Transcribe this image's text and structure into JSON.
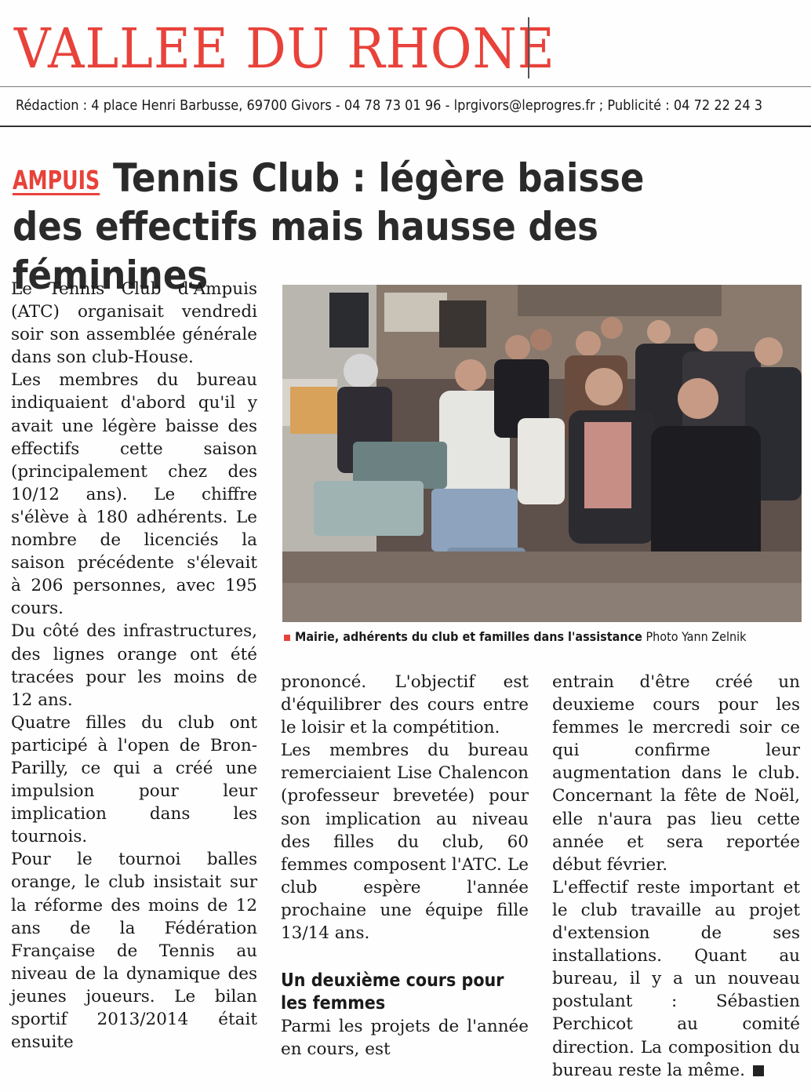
{
  "masthead": {
    "section": "VALLEE DU RHONE",
    "contact": "Rédaction : 4 place Henri Barbusse, 69700 Givors - 04 78 73 01 96 - lprgivors@leprogres.fr ; Publicité : 04 72 22 24 3"
  },
  "article": {
    "kicker": "AMPUIS",
    "headline_1": "Tennis Club : légère baisse",
    "headline_2": "des effectifs mais hausse des féminines",
    "col1": [
      "Le Tennis Club d'Ampuis (ATC) organisait vendredi soir son assemblée générale dans son club-House.",
      "Les membres du bureau indiquaient d'abord qu'il y avait une légère baisse des effectifs cette saison (principalement chez des 10/12 ans). Le chiffre s'élève à 180 adhérents. Le nombre de licenciés la saison précédente s'élevait à 206 personnes, avec 195 cours.",
      "Du côté des infrastructures, des lignes orange ont été tracées pour les moins de 12 ans.",
      "Quatre filles du club ont participé à l'open de Bron-Parilly, ce qui a créé une impulsion pour leur implication dans les tournois.",
      "Pour le tournoi balles orange, le club insistait sur la réforme des moins de 12 ans de la Fédération Française de Tennis au niveau de la dynamique des jeunes joueurs. Le bilan sportif 2013/2014 était ensuite"
    ],
    "col2": [
      "prononcé. L'objectif est d'équilibrer des cours entre le loisir et la compétition.",
      "Les membres du bureau remerciaient Lise Chalencon (professeur brevetée) pour son implication au niveau des filles du club, 60 femmes composent l'ATC. Le club espère l'année prochaine une équipe fille 13/14 ans."
    ],
    "subhead": "Un deuxième cours pour les femmes",
    "col2_after": "Parmi les projets de l'année en cours, est",
    "col3": [
      "entrain d'être créé un deuxieme cours pour les femmes le mercredi soir ce qui confirme leur augmentation dans le club. Concernant la fête de Noël, elle n'aura pas lieu cette année et sera reportée début février.",
      "L'effectif reste important et le club travaille au projet d'extension de ses installations. Quant au bureau, il y a un nouveau postulant : Sébastien Perchicot au comité direction. La composition du bureau reste la même."
    ],
    "caption": "Mairie, adhérents du club et familles dans l'assistance",
    "photo_credit": "Photo Yann Zelnik"
  },
  "colors": {
    "accent": "#e8423a",
    "text": "#1a1a1a"
  }
}
